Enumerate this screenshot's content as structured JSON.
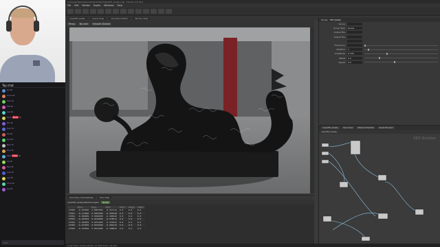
{
  "window": {
    "title": "C:/Users/HQ/Dropbox/Projects/Hip Files/VEX_Dragon.hip - Houdini FX 18.0"
  },
  "menu": [
    "File",
    "Edit",
    "Render",
    "Assets",
    "Windows",
    "Help"
  ],
  "path_tabs": [
    "/obj/VEX_twisty",
    "Scene View",
    "Animation Editor",
    "Render View"
  ],
  "viewport": {
    "toolbar": [
      "Persp",
      "No cam",
      "Smooth Shaded"
    ],
    "hud_text": "Persp"
  },
  "spreadsheet": {
    "tabs": [
      "Geometry Spreadsheet",
      "Tree View"
    ],
    "node": "Group",
    "node_path": "/obj/VEX_twisty/attribwrangle1",
    "columns": [
      "",
      "P[x]",
      "P[y]",
      "P[z]",
      "Cd[r]",
      "Cd[g]",
      "Cd[b]"
    ],
    "rows": [
      [
        "27050",
        "-0.135950",
        "0.0067000",
        "-0.317114",
        "0.0",
        "0.0",
        "0.0"
      ],
      [
        "27051",
        "-0.114095",
        "0.0051000",
        "-0.302520",
        "0.0",
        "0.0",
        "0.0"
      ],
      [
        "27052",
        "-0.186009",
        "0.0029000",
        "-0.306540",
        "0.0",
        "0.0",
        "0.0"
      ],
      [
        "27053",
        "-0.102654",
        "0.0145000",
        "-0.278011",
        "0.0",
        "0.0",
        "0.0"
      ],
      [
        "27054",
        "-0.160059",
        "0.0071000",
        "-0.321022",
        "0.0",
        "0.0",
        "0.0"
      ],
      [
        "27055",
        "-0.153055",
        "0.0012000",
        "-0.289410",
        "0.0",
        "0.0",
        "0.0"
      ],
      [
        "27056",
        "-0.129940",
        "0.0101000",
        "-0.308022",
        "0.0",
        "0.0",
        "0.0"
      ]
    ]
  },
  "params": {
    "node_type": "Range",
    "node_name": "VEX_twisty",
    "rows": [
      {
        "label": "Group",
        "value": ""
      },
      {
        "label": "Group Type",
        "value": "Guess"
      },
      {
        "label": "Output File",
        "value": ""
      },
      {
        "label": "Output File",
        "value": ""
      },
      {
        "label": "",
        "value": ""
      },
      {
        "label": "Frequency",
        "value": "",
        "knob": 0.0
      },
      {
        "label": "Rotation",
        "value": "1",
        "knob": 0.05
      },
      {
        "label": "Amplitude",
        "value": "0.156",
        "knob": 0.3
      },
      {
        "label": "Offset",
        "value": "0.2",
        "knob": 0.2
      },
      {
        "label": "Speed",
        "value": "0.5",
        "knob": 0.4
      }
    ]
  },
  "network": {
    "tabs": [
      "/obj/VEX_twisty",
      "Tree View",
      "Material Palette",
      "Asset Browser"
    ],
    "path": "/obj/VEX_twisty",
    "watermark": "VEX Builder"
  },
  "status_bar": "Cook Time: 0.012s   Points: 27,128   Prims: 54,232"
}
